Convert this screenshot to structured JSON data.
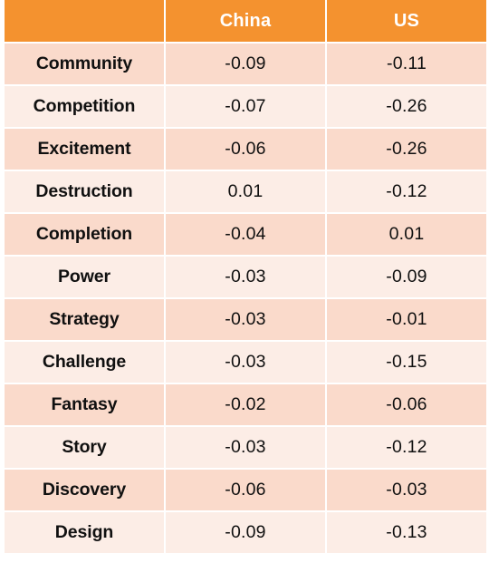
{
  "table": {
    "columns": [
      {
        "key": "label",
        "label": ""
      },
      {
        "key": "china",
        "label": "China"
      },
      {
        "key": "us",
        "label": "US"
      }
    ],
    "rows": [
      {
        "label": "Community",
        "china": "-0.09",
        "us": "-0.11"
      },
      {
        "label": "Competition",
        "china": "-0.07",
        "us": "-0.26"
      },
      {
        "label": "Excitement",
        "china": "-0.06",
        "us": "-0.26"
      },
      {
        "label": "Destruction",
        "china": "0.01",
        "us": "-0.12"
      },
      {
        "label": "Completion",
        "china": "-0.04",
        "us": "0.01"
      },
      {
        "label": "Power",
        "china": "-0.03",
        "us": "-0.09"
      },
      {
        "label": "Strategy",
        "china": "-0.03",
        "us": "-0.01"
      },
      {
        "label": "Challenge",
        "china": "-0.03",
        "us": "-0.15"
      },
      {
        "label": "Fantasy",
        "china": "-0.02",
        "us": "-0.06"
      },
      {
        "label": "Story",
        "china": "-0.03",
        "us": "-0.12"
      },
      {
        "label": "Discovery",
        "china": "-0.06",
        "us": "-0.03"
      },
      {
        "label": "Design",
        "china": "-0.09",
        "us": "-0.13"
      }
    ]
  },
  "colors": {
    "header_background": "#F4922F",
    "header_text": "#FFFFFF",
    "row_dark": "#FADACB",
    "row_light": "#FCEDE6",
    "body_text": "#101010",
    "page_background": "#FFFFFF"
  },
  "chart_data": {
    "type": "table",
    "title": "",
    "columns": [
      "",
      "China",
      "US"
    ],
    "categories": [
      "Community",
      "Competition",
      "Excitement",
      "Destruction",
      "Completion",
      "Power",
      "Strategy",
      "Challenge",
      "Fantasy",
      "Story",
      "Discovery",
      "Design"
    ],
    "series": [
      {
        "name": "China",
        "values": [
          -0.09,
          -0.07,
          -0.06,
          0.01,
          -0.04,
          -0.03,
          -0.03,
          -0.03,
          -0.02,
          -0.03,
          -0.06,
          -0.09
        ]
      },
      {
        "name": "US",
        "values": [
          -0.11,
          -0.26,
          -0.26,
          -0.12,
          0.01,
          -0.09,
          -0.01,
          -0.15,
          -0.06,
          -0.12,
          -0.03,
          -0.13
        ]
      }
    ],
    "xlabel": "",
    "ylabel": "",
    "grid": false,
    "legend": "none"
  }
}
